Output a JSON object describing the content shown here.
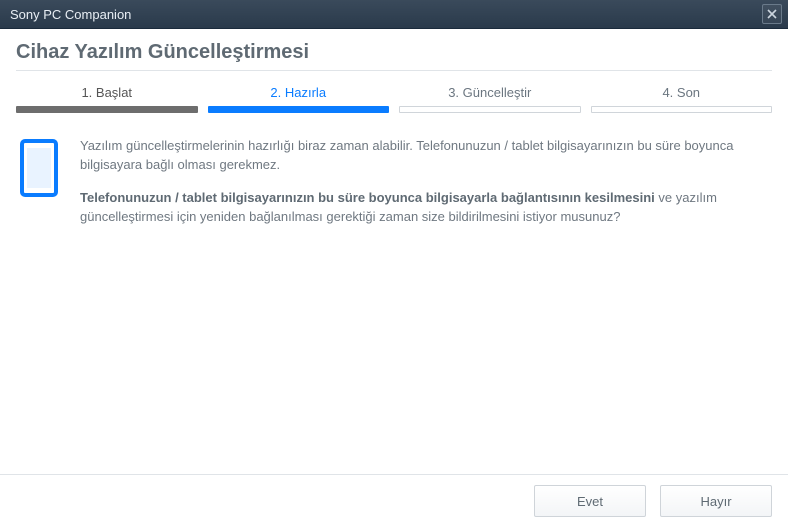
{
  "window": {
    "title": "Sony PC Companion"
  },
  "page": {
    "title": "Cihaz Yazılım Güncelleştirmesi"
  },
  "steps": {
    "items": [
      {
        "label": "1. Başlat",
        "state": "done"
      },
      {
        "label": "2. Hazırla",
        "state": "active"
      },
      {
        "label": "3. Güncelleştir",
        "state": "pending"
      },
      {
        "label": "4. Son",
        "state": "pending"
      }
    ]
  },
  "body": {
    "info": "Yazılım güncelleştirmelerinin hazırlığı biraz zaman alabilir. Telefonunuzun / tablet bilgisayarınızın bu süre boyunca bilgisayara bağlı olması gerekmez.",
    "question_bold": "Telefonunuzun / tablet bilgisayarınızın bu süre boyunca bilgisayarla bağlantısının kesilmesini",
    "question_rest": " ve yazılım güncelleştirmesi için yeniden bağlanılması gerektiği zaman size bildirilmesini istiyor musunuz?"
  },
  "buttons": {
    "yes": "Evet",
    "no": "Hayır"
  }
}
